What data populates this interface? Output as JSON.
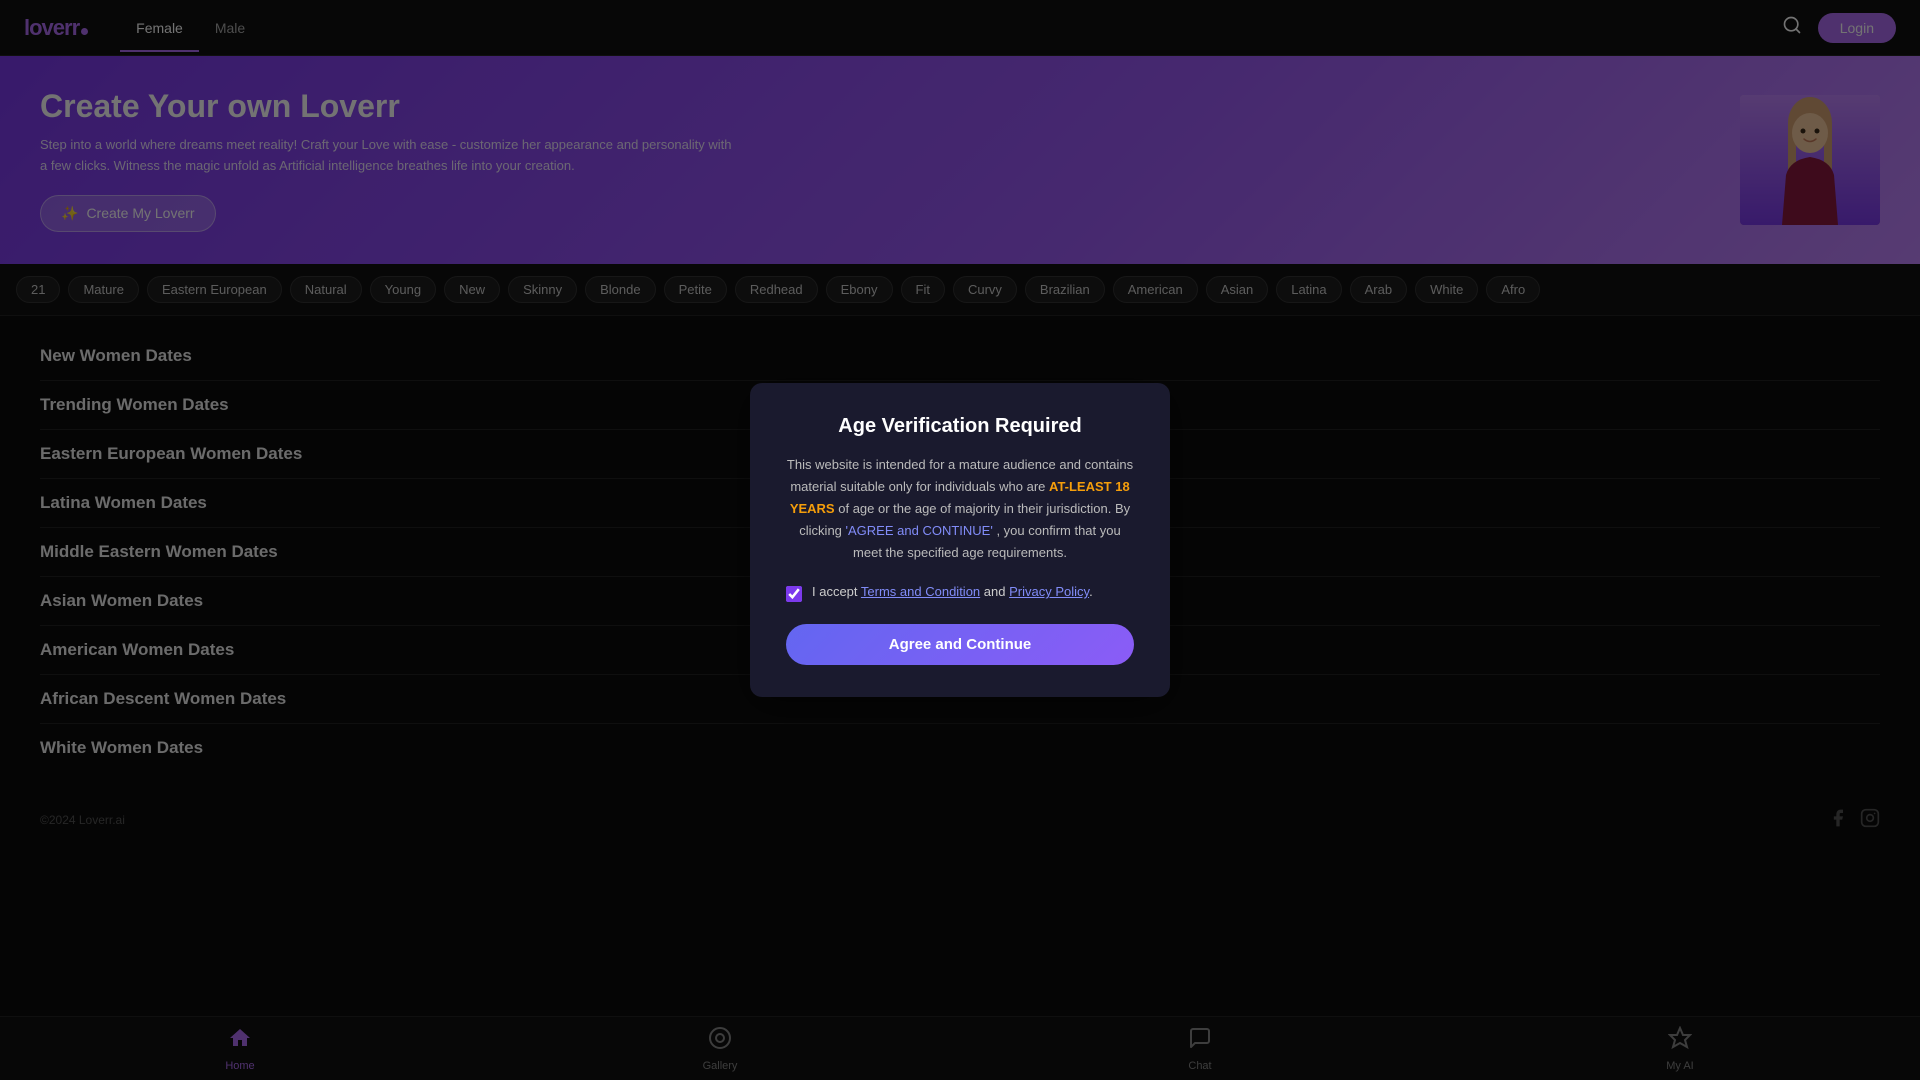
{
  "app": {
    "name": "loverr",
    "logo_dot": "•"
  },
  "navbar": {
    "tabs": [
      {
        "id": "female",
        "label": "Female",
        "active": true
      },
      {
        "id": "male",
        "label": "Male",
        "active": false
      }
    ],
    "search_label": "Search",
    "login_label": "Login"
  },
  "hero": {
    "title": "Create Your own Loverr",
    "description": "Step into a world where dreams meet reality! Craft your Love with ease - customize her appearance and personality with a few clicks. Witness the magic unfold as Artificial intelligence breathes life into your creation.",
    "cta_label": "Create My Loverr",
    "cta_icon": "✨"
  },
  "chips": [
    "21",
    "Mature",
    "Eastern European",
    "Natural",
    "Young",
    "New",
    "Skinny",
    "Blonde",
    "Petite",
    "Redhead",
    "Ebony",
    "Fit",
    "Curvy",
    "Brazilian",
    "American",
    "Asian",
    "Latina",
    "Arab",
    "White",
    "Afro"
  ],
  "sections": [
    {
      "id": "new",
      "label": "New Women Dates"
    },
    {
      "id": "trending",
      "label": "Trending Women Dates"
    },
    {
      "id": "eastern-european",
      "label": "Eastern European Women Dates"
    },
    {
      "id": "latina",
      "label": "Latina Women Dates"
    },
    {
      "id": "middle-eastern",
      "label": "Middle Eastern Women Dates"
    },
    {
      "id": "asian",
      "label": "Asian Women Dates"
    },
    {
      "id": "american",
      "label": "American Women Dates"
    },
    {
      "id": "african-descent",
      "label": "African Descent Women Dates"
    },
    {
      "id": "white",
      "label": "White Women Dates"
    }
  ],
  "footer": {
    "copyright": "©2024 Loverr.ai",
    "social": [
      "facebook",
      "instagram"
    ]
  },
  "bottom_nav": [
    {
      "id": "home",
      "label": "Home",
      "icon": "🏠",
      "active": true
    },
    {
      "id": "gallery",
      "label": "Gallery",
      "icon": "◎",
      "active": false
    },
    {
      "id": "chat",
      "label": "Chat",
      "icon": "💬",
      "active": false
    },
    {
      "id": "my-ai",
      "label": "My AI",
      "icon": "✦",
      "active": false
    }
  ],
  "modal": {
    "title": "Age Verification Required",
    "body_1": "This website is intended for a mature audience and contains material suitable only for individuals who are",
    "body_highlight": "AT-LEAST 18 YEARS",
    "body_2": "of age or the age of majority in their jurisdiction. By clicking",
    "body_link": "'AGREE and CONTINUE'",
    "body_3": ", you confirm that you meet the specified age requirements.",
    "accept_prefix": "I accept",
    "terms_label": "Terms and Condition",
    "and_text": "and",
    "privacy_label": "Privacy Policy",
    "period": ".",
    "checkbox_checked": true,
    "cta_label": "Agree and Continue"
  }
}
